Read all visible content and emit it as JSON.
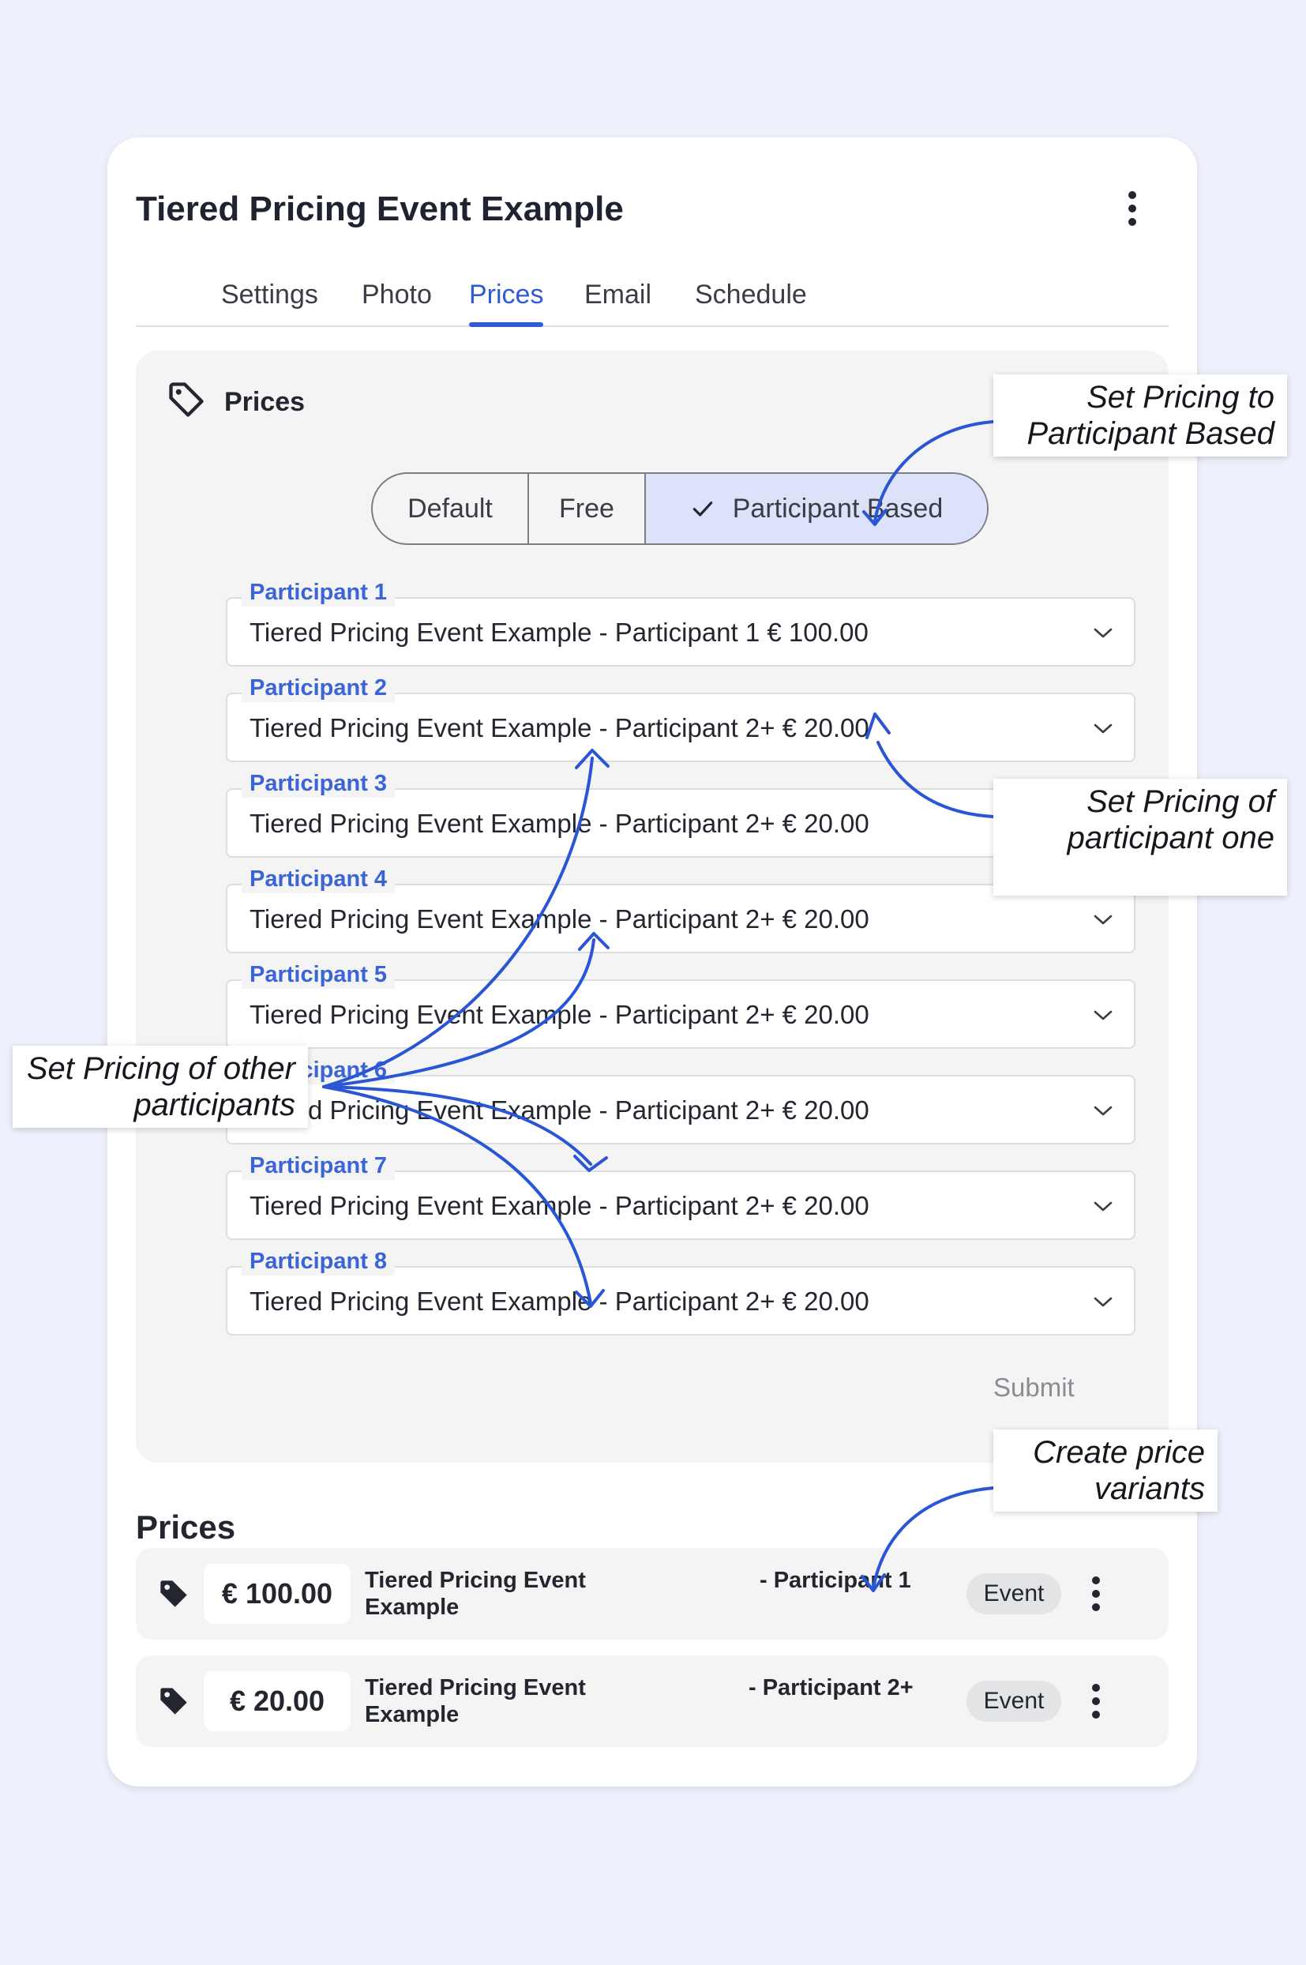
{
  "card": {
    "title": "Tiered Pricing Event Example",
    "tabs": [
      "Settings",
      "Photo",
      "Prices",
      "Email",
      "Schedule"
    ],
    "active_tab": "Prices"
  },
  "pricing_panel": {
    "title": "Prices",
    "modes": [
      {
        "label": "Default",
        "selected": false
      },
      {
        "label": "Free",
        "selected": false
      },
      {
        "label": "Participant Based",
        "selected": true
      }
    ],
    "participants": [
      {
        "label": "Participant 1",
        "value": "Tiered Pricing Event Example - Participant 1 € 100.00"
      },
      {
        "label": "Participant 2",
        "value": "Tiered Pricing Event Example - Participant 2+ € 20.00"
      },
      {
        "label": "Participant 3",
        "value": "Tiered Pricing Event Example - Participant 2+ € 20.00"
      },
      {
        "label": "Participant 4",
        "value": "Tiered Pricing Event Example - Participant 2+ € 20.00"
      },
      {
        "label": "Participant 5",
        "value": "Tiered Pricing Event Example - Participant 2+ € 20.00"
      },
      {
        "label": "Participant 6",
        "value": "Tiered Pricing Event Example - Participant 2+ € 20.00"
      },
      {
        "label": "Participant 7",
        "value": "Tiered Pricing Event Example - Participant 2+ € 20.00"
      },
      {
        "label": "Participant 8",
        "value": "Tiered Pricing Event Example - Participant 2+ € 20.00"
      }
    ],
    "submit_label": "Submit"
  },
  "prices_section": {
    "title": "Prices",
    "items": [
      {
        "amount": "€ 100.00",
        "name": "Tiered Pricing Event Example",
        "suffix": "- Participant 1",
        "badge": "Event"
      },
      {
        "amount": "€ 20.00",
        "name": "Tiered Pricing Event Example",
        "suffix": "- Participant 2+",
        "badge": "Event"
      }
    ]
  },
  "annotations": {
    "participant_based": "Set Pricing to Participant Based",
    "participant_one": "Set Pricing of participant one",
    "other_participants": "Set Pricing of other participants",
    "price_variants": "Create price variants"
  },
  "colors": {
    "background": "#eef1fb",
    "accent": "#2f5bd3",
    "field_label": "#3b64d6",
    "selected_segment": "#dbe2f9",
    "annotation_arrow": "#2a56d6"
  },
  "icons": [
    "more-vert-icon",
    "tag-outline-icon",
    "check-icon",
    "chevron-down-icon",
    "tag-filled-icon"
  ]
}
